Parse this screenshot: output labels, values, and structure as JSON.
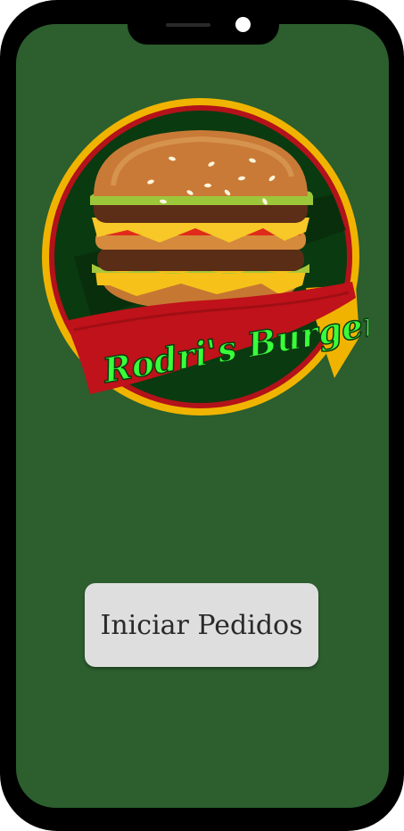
{
  "logo": {
    "brand_name": "Rodri's Burger"
  },
  "main": {
    "start_button_label": "Iniciar Pedidos"
  },
  "colors": {
    "screen_background": "#2c5e2e",
    "frame": "#000000",
    "ribbon_red": "#c0121a",
    "logo_ring_gold": "#f0b400",
    "brand_text_green": "#39ff3a",
    "button_background": "#dedede"
  }
}
